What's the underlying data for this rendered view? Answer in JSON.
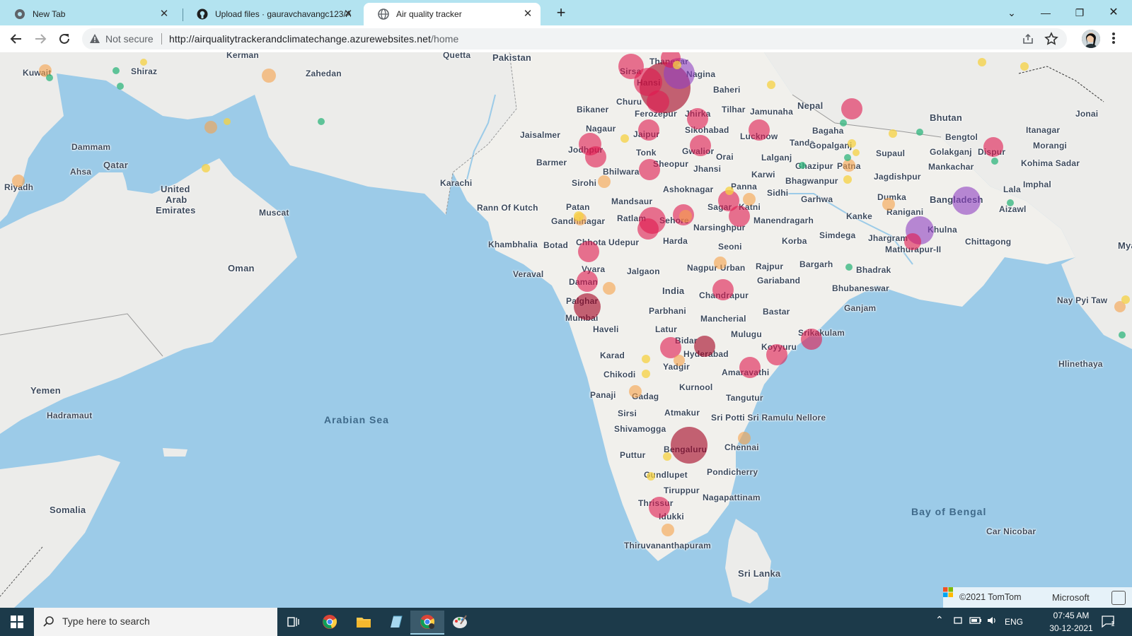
{
  "tabs": [
    {
      "title": "New Tab",
      "icon": "chrome-icon"
    },
    {
      "title": "Upload files · gauravchavangc123/A",
      "icon": "github-icon"
    },
    {
      "title": "Air quality tracker",
      "icon": "globe-icon",
      "active": true
    }
  ],
  "toolbar": {
    "security_label": "Not secure",
    "url_host": "http://airqualitytrackerandclimatechange.azurewebsites.net",
    "url_path": "/home"
  },
  "map": {
    "labels": {
      "countries": [
        "Pakistan",
        "Nepal",
        "Bhutan",
        "Bangladesh",
        "India",
        "Oman",
        "Qatar",
        "United",
        "Arab",
        "Emirates",
        "Yemen",
        "Somalia",
        "Sri Lanka",
        "Myan",
        "Kuwait"
      ],
      "seas": [
        "Arabian Sea",
        "Bay of Bengal"
      ],
      "cities": [
        "Kerman",
        "Quetta",
        "Shiraz",
        "Zahedan",
        "Dammam",
        "Ahsa",
        "Riyadh",
        "Muscat",
        "Hadramaut",
        "Karachi",
        "Rann Of Kutch",
        "Khambhalia",
        "Botad",
        "Veraval",
        "Jaisalmer",
        "Barmer",
        "Bikaner",
        "Nagaur",
        "Jodhpur",
        "Sirohi",
        "Patan",
        "Gandhinagar",
        "Chhota Udepur",
        "Vyara",
        "Daman",
        "Palghar",
        "Mumbai",
        "Haveli",
        "Karad",
        "Chikodi",
        "Panaji",
        "Gadag",
        "Sirsi",
        "Shivamogga",
        "Puttur",
        "Bengaluru",
        "Gundlupet",
        "Tiruppur",
        "Thrissur",
        "Idukki",
        "Thiruvananthapuram",
        "Sirsa",
        "Thanesar",
        "Nagina",
        "Hansi",
        "Churu",
        "Baheri",
        "Tilhar",
        "Ferozepur",
        "Jhirka",
        "Jaipur",
        "Sikohabad",
        "Tonk",
        "Gwalior",
        "Orai",
        "Sheopur",
        "Jhansi",
        "Bhilwara",
        "Ashoknagar",
        "Mandsaur",
        "Ratlam",
        "Sehore",
        "Harda",
        "Sagar",
        "Katni",
        "Panna",
        "Narsinghpur",
        "Seoni",
        "Jalgaon",
        "Nagpur Urban",
        "Chandrapur",
        "Parbhani",
        "Mancherial",
        "Latur",
        "Bidar",
        "Hyderabad",
        "Mulugu",
        "Yadgir",
        "Kurnool",
        "Tangutur",
        "Atmakur",
        "Sri Potti Sri Ramulu Nellore",
        "Chennai",
        "Pondicherry",
        "Nagapattinam",
        "Amaravathi",
        "Koyyuru",
        "Srikakulam",
        "Bastar",
        "Rajpur",
        "Gariaband",
        "Korba",
        "Bargarh",
        "Bhubaneswar",
        "Ganjam",
        "Bhadrak",
        "Manendragarh",
        "Simdega",
        "Kanke",
        "Jhargram",
        "Mathurapur-II",
        "Khulna",
        "Chittagong",
        "Ranigani",
        "Dumka",
        "Sidhi",
        "Karwi",
        "Lucknow",
        "Tanda",
        "Lalganj",
        "Ghazipur",
        "Patna",
        "Bhagwanpur",
        "Garhwa",
        "Jagdishpur",
        "Gopalganj",
        "Bagaha",
        "Jamunaha",
        "Supaul",
        "Bengtol",
        "Golakganj",
        "Dispur",
        "Mankachar",
        "Itanagar",
        "Jonai",
        "Morangi",
        "Kohima Sadar",
        "Imphal",
        "Lala",
        "Aizawl",
        "Nay Pyi Taw",
        "Hlinethaya",
        "Car Nicobar"
      ]
    },
    "attribution": "©2021 TomTom",
    "attribution_brand": "Microsoft"
  },
  "legend_colors": {
    "good": "#2fb67c",
    "moderate": "#f5d142",
    "sensitive": "#f7a24a",
    "unhealthy": "#e0194f",
    "very_unhealthy": "#8f3fc2",
    "hazardous": "#a3001f"
  },
  "taskbar": {
    "search_placeholder": "Type here to search",
    "language": "ENG",
    "time": "07:45 AM",
    "date": "30-12-2021",
    "notification_count": "1"
  }
}
